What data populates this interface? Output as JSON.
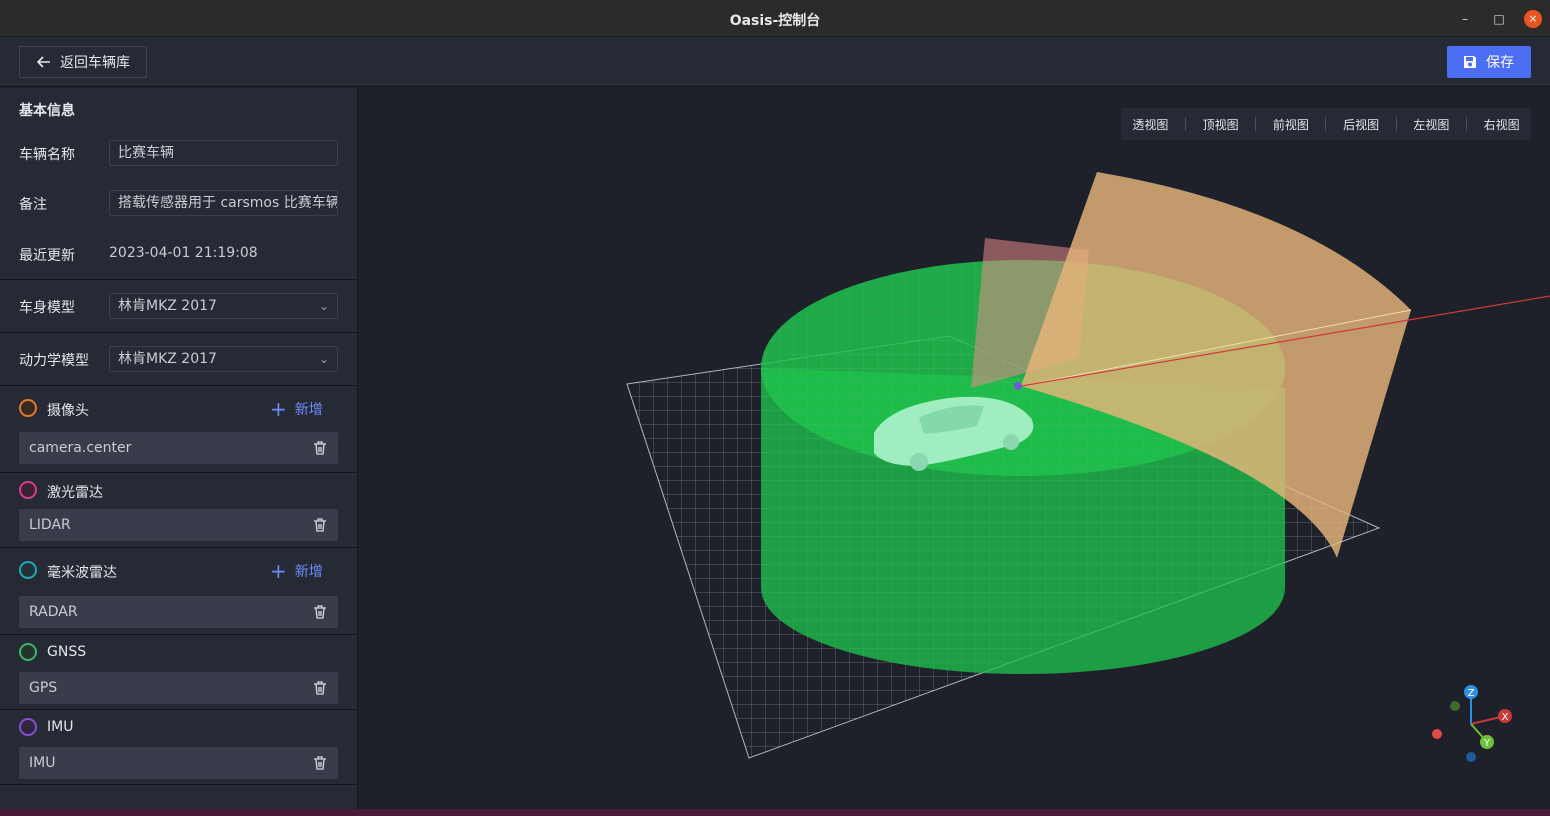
{
  "window": {
    "title": "Oasis-控制台",
    "minimize": "–",
    "maximize": "□",
    "close": "×"
  },
  "toolbar": {
    "back_label": "返回车辆库",
    "save_label": "保存"
  },
  "basic_info": {
    "heading": "基本信息",
    "name_label": "车辆名称",
    "name_value": "比赛车辆",
    "note_label": "备注",
    "note_value": "搭载传感器用于 carsmos 比赛车辆",
    "updated_label": "最近更新",
    "updated_value": "2023-04-01 21:19:08"
  },
  "body_model": {
    "label": "车身模型",
    "value": "林肯MKZ 2017"
  },
  "dynamics_model": {
    "label": "动力学模型",
    "value": "林肯MKZ 2017"
  },
  "sensors": {
    "add_label": "新增",
    "camera": {
      "label": "摄像头",
      "icon": "camera-icon",
      "color": "#e07a2e",
      "items": [
        "camera.center"
      ]
    },
    "lidar": {
      "label": "激光雷达",
      "icon": "lidar-icon",
      "color": "#d13f8e",
      "items": [
        "LIDAR"
      ]
    },
    "radar": {
      "label": "毫米波雷达",
      "icon": "radar-icon",
      "color": "#1ea7b8",
      "items": [
        "RADAR"
      ]
    },
    "gnss": {
      "label": "GNSS",
      "icon": "gnss-icon",
      "color": "#3cb46e",
      "items": [
        "GPS"
      ]
    },
    "imu": {
      "label": "IMU",
      "icon": "imu-icon",
      "color": "#8a4fd0",
      "items": [
        "IMU"
      ]
    }
  },
  "views": [
    "透视图",
    "顶视图",
    "前视图",
    "后视图",
    "左视图",
    "右视图"
  ],
  "axes": {
    "x": "X",
    "y": "Y",
    "z": "Z"
  },
  "colors": {
    "accent": "#4c6ef5",
    "lidar_volume": "#1fc24b",
    "camera_fov": "#e8b57a",
    "radar_fov": "#e58a8a"
  }
}
